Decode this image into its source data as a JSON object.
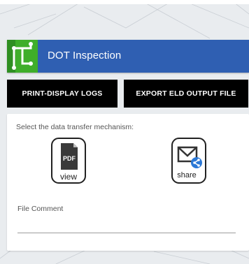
{
  "header": {
    "title": "DOT Inspection"
  },
  "actions": {
    "print_label": "PRINT-DISPLAY LOGS",
    "export_label": "EXPORT ELD OUTPUT FILE"
  },
  "transfer": {
    "prompt": "Select the data transfer mechanism:",
    "pdf_option": {
      "icon": "pdf-view-icon",
      "badge": "PDF",
      "caption": "view"
    },
    "share_option": {
      "icon": "mail-share-icon",
      "caption": "share"
    }
  },
  "comment": {
    "label": "File Comment",
    "value": ""
  },
  "colors": {
    "header": "#2f5fb2",
    "logo_green": "#3fae2a",
    "button": "#000000",
    "share_badge": "#2b78d6"
  }
}
